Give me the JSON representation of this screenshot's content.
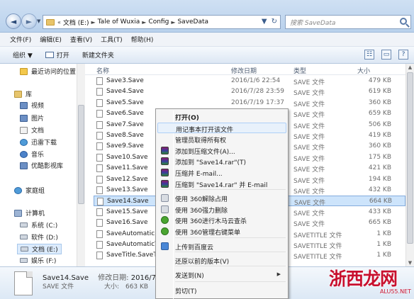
{
  "address": {
    "back_glyph": "◄",
    "forward_glyph": "►",
    "breadcrumb_prefix": "«",
    "crumbs": [
      "文档 (E:)",
      "Tale of Wuxia",
      "Config",
      "SaveData"
    ],
    "separator": "►",
    "dropdown_glyph": "▼",
    "refresh_glyph": "↻"
  },
  "search": {
    "placeholder": "搜索 SaveData"
  },
  "menubar": {
    "items": [
      "文件(F)",
      "编辑(E)",
      "查看(V)",
      "工具(T)",
      "帮助(H)"
    ]
  },
  "toolbar": {
    "organize": "组织 ▼",
    "open": "打开",
    "new_folder": "新建文件夹",
    "view_glyph": "☷",
    "preview_glyph": "▭",
    "help_glyph": "?"
  },
  "navpane": {
    "recent": "最近访问的位置",
    "library": "库",
    "videos": "视频",
    "pictures": "图片",
    "documents": "文档",
    "thunder": "迅雷下载",
    "music": "音乐",
    "youku": "优酷影视库",
    "homegroup": "家庭组",
    "computer": "计算机",
    "drive_c": "系统 (C:)",
    "drive_d": "软件 (D:)",
    "drive_e": "文档 (E:)",
    "drive_f": "娱乐 (F:)",
    "network": "网络"
  },
  "columns": {
    "name": "名称",
    "date": "修改日期",
    "type": "类型",
    "size": "大小"
  },
  "files": [
    {
      "name": "Save3.Save",
      "date": "2016/1/6 22:54",
      "type": "SAVE 文件",
      "size": "479 KB"
    },
    {
      "name": "Save4.Save",
      "date": "2016/7/28 23:59",
      "type": "SAVE 文件",
      "size": "619 KB"
    },
    {
      "name": "Save5.Save",
      "date": "2016/7/19 17:37",
      "type": "SAVE 文件",
      "size": "360 KB"
    },
    {
      "name": "Save6.Save",
      "date": "",
      "type": "SAVE 文件",
      "size": "659 KB"
    },
    {
      "name": "Save7.Save",
      "date": "",
      "type": "SAVE 文件",
      "size": "506 KB"
    },
    {
      "name": "Save8.Save",
      "date": "",
      "type": "SAVE 文件",
      "size": "419 KB"
    },
    {
      "name": "Save9.Save",
      "date": "",
      "type": "SAVE 文件",
      "size": "360 KB"
    },
    {
      "name": "Save10.Save",
      "date": "",
      "type": "SAVE 文件",
      "size": "175 KB"
    },
    {
      "name": "Save11.Save",
      "date": "",
      "type": "SAVE 文件",
      "size": "421 KB"
    },
    {
      "name": "Save12.Save",
      "date": "",
      "type": "SAVE 文件",
      "size": "194 KB"
    },
    {
      "name": "Save13.Save",
      "date": "",
      "type": "SAVE 文件",
      "size": "432 KB"
    },
    {
      "name": "Save14.Save",
      "date": "",
      "type": "SAVE 文件",
      "size": "664 KB",
      "selected": true
    },
    {
      "name": "Save15.Save",
      "date": "",
      "type": "SAVE 文件",
      "size": "433 KB"
    },
    {
      "name": "Save16.Save",
      "date": "",
      "type": "SAVE 文件",
      "size": "665 KB"
    },
    {
      "name": "SaveAutomaticD",
      "date": "",
      "type": "SAVETITLE 文件",
      "size": "1 KB"
    },
    {
      "name": "SaveAutomaticTi",
      "date": "",
      "type": "SAVETITLE 文件",
      "size": "1 KB"
    },
    {
      "name": "SaveTitle.SaveTit",
      "date": "",
      "type": "SAVETITLE 文件",
      "size": "1 KB"
    }
  ],
  "details": {
    "name": "Save14.Save",
    "modified_label": "修改日期:",
    "modified": "2016/7/31 22",
    "type": "SAVE 文件",
    "size_label": "大小:",
    "size": "663 KB"
  },
  "context_menu": {
    "items": [
      {
        "label": "打开(O)",
        "bold": true
      },
      {
        "label": "用记事本打开该文件",
        "highlighted": true
      },
      {
        "label": "管理员取得所有权"
      },
      {
        "label": "添加到压缩文件(A)...",
        "icon": "rar"
      },
      {
        "label": "添加到 \"Save14.rar\"(T)",
        "icon": "rar"
      },
      {
        "label": "压缩并 E-mail...",
        "icon": "rar"
      },
      {
        "label": "压缩到 \"Save14.rar\" 并 E-mail",
        "icon": "rar"
      },
      {
        "label": "使用 360解除占用",
        "icon": "shield"
      },
      {
        "label": "使用 360强力删除",
        "icon": "shield"
      },
      {
        "label": "使用 360进行木马云查杀",
        "icon": "green"
      },
      {
        "label": "使用 360管理右键菜单",
        "icon": "green"
      },
      {
        "label": "上传到百度云",
        "icon": "blue"
      },
      {
        "label": "还原以前的版本(V)"
      },
      {
        "label": "发送到(N)",
        "submenu": true
      },
      {
        "label": "剪切(T)"
      }
    ],
    "submenu_glyph": "▶"
  },
  "watermark": {
    "main": "浙西龙网",
    "sub": "ALU55.NET"
  }
}
